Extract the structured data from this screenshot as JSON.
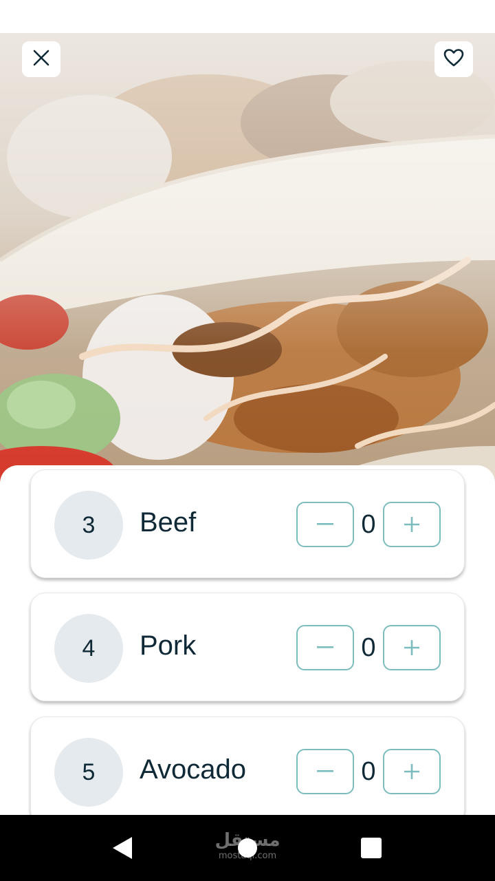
{
  "header": {
    "close_icon": "close-icon",
    "favorite_icon": "heart-icon"
  },
  "items": [
    {
      "number": "3",
      "name": "Beef",
      "quantity": "0",
      "minus_label": "−",
      "plus_label": "+"
    },
    {
      "number": "4",
      "name": "Pork",
      "quantity": "0",
      "minus_label": "−",
      "plus_label": "+"
    },
    {
      "number": "5",
      "name": "Avocado",
      "quantity": "0",
      "minus_label": "−",
      "plus_label": "+"
    }
  ],
  "watermark": {
    "arabic": "مستقل",
    "latin": "mostaql.com"
  },
  "nav": {
    "back_icon": "triangle-back-icon",
    "home_icon": "circle-home-icon",
    "recents_icon": "square-recents-icon"
  },
  "colors": {
    "text_dark": "#0f2a36",
    "stepper_border": "#7bbcbe",
    "circle_bg": "#e5eaee",
    "nav_bg": "#000000"
  }
}
